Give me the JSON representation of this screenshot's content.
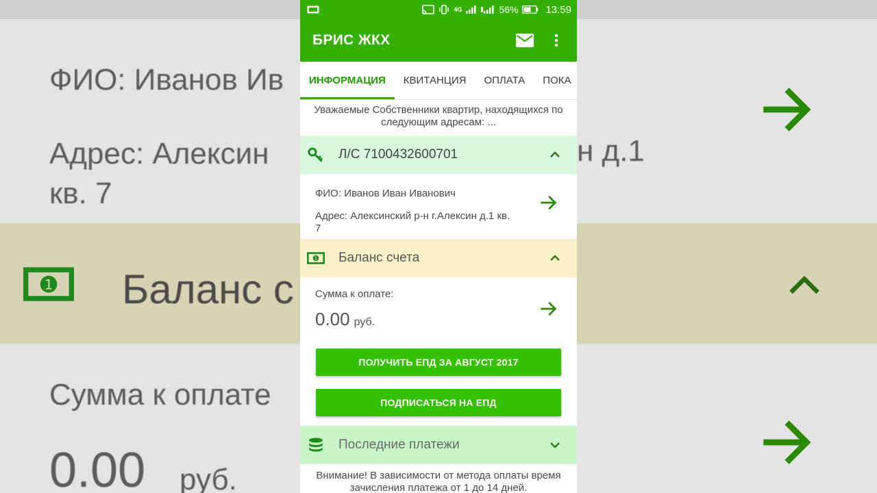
{
  "status_bar": {
    "battery_percent": "56%",
    "time": "13:59",
    "network_label": "4G",
    "icons": [
      "notification-icon",
      "cast-icon",
      "vibrate-icon",
      "network-4g-icon",
      "signal-icon",
      "signal-hd-icon",
      "battery-icon"
    ]
  },
  "app_bar": {
    "title": "БРИС ЖКХ",
    "icons": [
      "mail-icon",
      "more-vert-icon"
    ]
  },
  "tabs": [
    {
      "label": "ИНФОРМАЦИЯ",
      "active": true
    },
    {
      "label": "КВИТАНЦИЯ",
      "active": false
    },
    {
      "label": "ОПЛАТА",
      "active": false
    },
    {
      "label": "ПОКА",
      "active": false
    }
  ],
  "notice": "Уважаемые Собственники квартир, находящихся по следующим адресам: ...",
  "account_section": {
    "title": "Л/С 7100432600701",
    "icon": "key-icon",
    "expanded": true,
    "fio": "ФИО: Иванов Иван Иванович",
    "address": "Адрес: Алексинский р-н г.Алексин д.1 кв. 7"
  },
  "balance_section": {
    "title": "Баланс счета",
    "icon": "money-icon",
    "expanded": true,
    "amount_label": "Сумма к оплате:",
    "amount": "0.00",
    "currency": "руб."
  },
  "buttons": {
    "get_epd": "ПОЛУЧИТЬ ЕПД ЗА АВГУСТ 2017",
    "subscribe_epd": "ПОДПИСАТЬСЯ НА ЕПД"
  },
  "payments_section": {
    "title": "Последние платежи",
    "icon": "database-icon",
    "expanded": false,
    "note": "Внимание! В зависимости от метода оплаты время зачисления платежа от 1 до 14 дней."
  },
  "background_zoom": {
    "fio": "ФИО: Иванов Ив",
    "address_line1": "Адрес: Алексин",
    "address_tail": "н д.1",
    "address_line2": "кв. 7",
    "balance": "Баланс с",
    "sum": "Сумма к оплате",
    "amount": "0.00",
    "currency": "руб."
  },
  "colors": {
    "app_bar": "#33b000",
    "accent": "#1f9e00",
    "button": "#33c200",
    "account_header": "#d9f8e0",
    "balance_header": "#fbf1c9",
    "payments_header": "#c8f5c8"
  }
}
